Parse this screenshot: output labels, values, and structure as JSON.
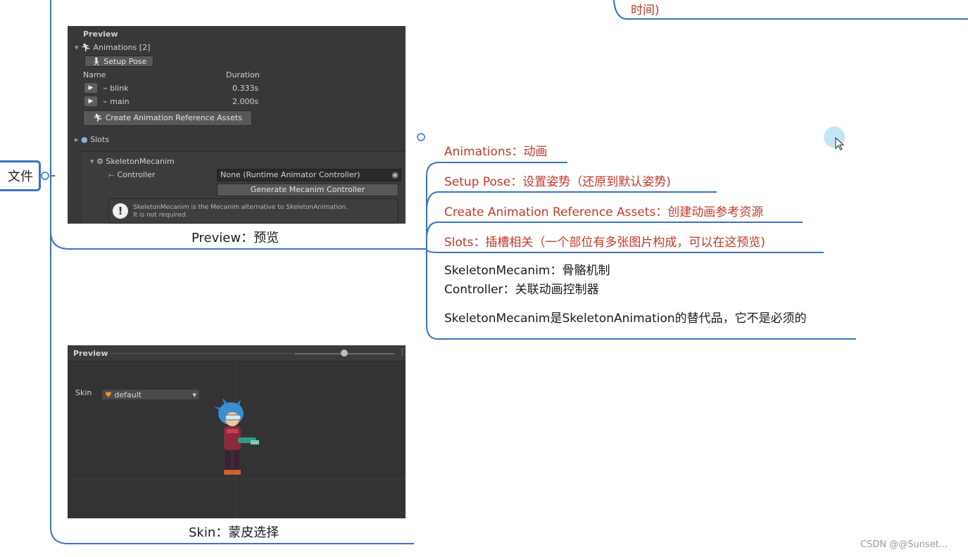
{
  "root": {
    "label": "文件"
  },
  "top_fragment": {
    "text": "时间)"
  },
  "preview_panel": {
    "header": "Preview",
    "animations_label": "Animations [2]",
    "setup_pose_button": "Setup Pose",
    "columns": [
      "Name",
      "Duration"
    ],
    "animations": [
      {
        "name": "blink",
        "duration": "0.333s"
      },
      {
        "name": "main",
        "duration": "2.000s"
      }
    ],
    "create_assets_button": "Create Animation Reference Assets",
    "slots_label": "Slots",
    "component_label": "SkeletonMecanim",
    "controller_label": "Controller",
    "controller_value": "None (Runtime Animator Controller)",
    "generate_button": "Generate Mecanim Controller",
    "help_line1": "SkeletonMecanim is the Mecanim alternative to SkeletonAnimation.",
    "help_line2": "It is not required."
  },
  "preview_caption": "Preview：预览",
  "skin_panel": {
    "header": "Preview",
    "skin_label": "Skin",
    "skin_value": "default"
  },
  "skin_caption": "Skin：蒙皮选择",
  "branches": [
    {
      "text": "Animations：动画"
    },
    {
      "text": "Setup Pose：设置姿势（还原到默认姿势)"
    },
    {
      "text": "Create Animation Reference Assets：创建动画参考资源"
    },
    {
      "text": "Slots：插槽相关（一个部位有多张图片构成，可以在这预览)"
    }
  ],
  "note": {
    "line1": "SkeletonMecanim：骨骼机制",
    "line2": "Controller：关联动画控制器",
    "line3": "SkeletonMecanim是SkeletonAnimation的替代品，它不是必须的"
  },
  "watermark": "CSDN @@Sunset...",
  "colors": {
    "branch_line": "#3a72c4",
    "red_text": "#c0392b",
    "panel_bg": "#383838"
  }
}
